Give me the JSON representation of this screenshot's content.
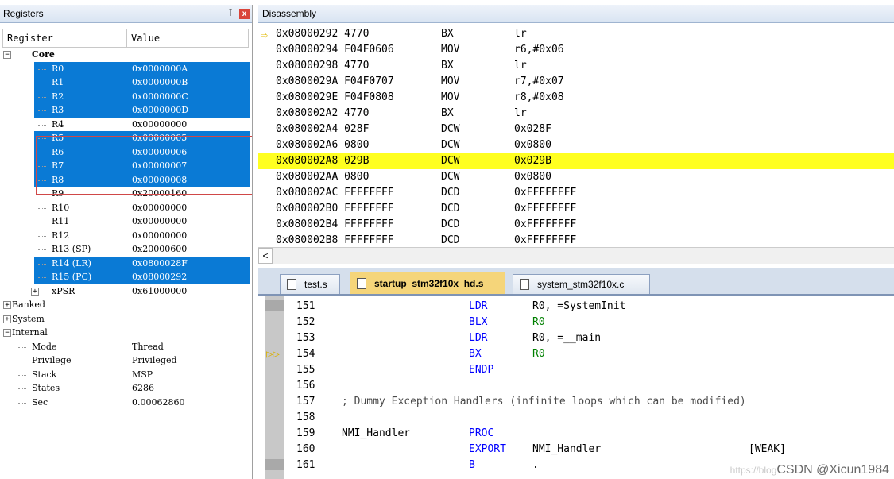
{
  "registers_panel": {
    "title": "Registers",
    "pin_glyph": "⍑",
    "close_glyph": "x",
    "col_register": "Register",
    "col_value": "Value",
    "core_label": "Core",
    "core_regs": [
      {
        "name": "R0",
        "value": "0x0000000A",
        "selected": true
      },
      {
        "name": "R1",
        "value": "0x0000000B",
        "selected": true
      },
      {
        "name": "R2",
        "value": "0x0000000C",
        "selected": true
      },
      {
        "name": "R3",
        "value": "0x0000000D",
        "selected": true
      },
      {
        "name": "R4",
        "value": "0x00000000",
        "selected": false
      },
      {
        "name": "R5",
        "value": "0x00000005",
        "selected": true
      },
      {
        "name": "R6",
        "value": "0x00000006",
        "selected": true
      },
      {
        "name": "R7",
        "value": "0x00000007",
        "selected": true
      },
      {
        "name": "R8",
        "value": "0x00000008",
        "selected": true
      },
      {
        "name": "R9",
        "value": "0x20000160",
        "selected": false
      },
      {
        "name": "R10",
        "value": "0x00000000",
        "selected": false
      },
      {
        "name": "R11",
        "value": "0x00000000",
        "selected": false
      },
      {
        "name": "R12",
        "value": "0x00000000",
        "selected": false
      },
      {
        "name": "R13 (SP)",
        "value": "0x20000600",
        "selected": false
      },
      {
        "name": "R14 (LR)",
        "value": "0x0800028F",
        "selected": true
      },
      {
        "name": "R15 (PC)",
        "value": "0x08000292",
        "selected": true
      }
    ],
    "xpsr": {
      "name": "xPSR",
      "value": "0x61000000"
    },
    "banked_label": "Banked",
    "system_label": "System",
    "internal_label": "Internal",
    "internal_items": [
      {
        "name": "Mode",
        "value": "Thread"
      },
      {
        "name": "Privilege",
        "value": "Privileged"
      },
      {
        "name": "Stack",
        "value": "MSP"
      },
      {
        "name": "States",
        "value": "6286"
      },
      {
        "name": "Sec",
        "value": "0.00062860"
      }
    ]
  },
  "disassembly": {
    "title": "Disassembly",
    "lines": [
      {
        "addr": "0x08000292 4770",
        "mn": "BX",
        "ops": "lr",
        "current": false,
        "arrow": true
      },
      {
        "addr": "0x08000294 F04F0606",
        "mn": "MOV",
        "ops": "r6,#0x06",
        "current": false,
        "arrow": false
      },
      {
        "addr": "0x08000298 4770",
        "mn": "BX",
        "ops": "lr",
        "current": false,
        "arrow": false
      },
      {
        "addr": "0x0800029A F04F0707",
        "mn": "MOV",
        "ops": "r7,#0x07",
        "current": false,
        "arrow": false
      },
      {
        "addr": "0x0800029E F04F0808",
        "mn": "MOV",
        "ops": "r8,#0x08",
        "current": false,
        "arrow": false
      },
      {
        "addr": "0x080002A2 4770",
        "mn": "BX",
        "ops": "lr",
        "current": false,
        "arrow": false
      },
      {
        "addr": "0x080002A4 028F",
        "mn": "DCW",
        "ops": "0x028F",
        "current": false,
        "arrow": false
      },
      {
        "addr": "0x080002A6 0800",
        "mn": "DCW",
        "ops": "0x0800",
        "current": false,
        "arrow": false
      },
      {
        "addr": "0x080002A8 029B",
        "mn": "DCW",
        "ops": "0x029B",
        "current": true,
        "arrow": false
      },
      {
        "addr": "0x080002AA 0800",
        "mn": "DCW",
        "ops": "0x0800",
        "current": false,
        "arrow": false
      },
      {
        "addr": "0x080002AC FFFFFFFF",
        "mn": "DCD",
        "ops": "0xFFFFFFFF",
        "current": false,
        "arrow": false
      },
      {
        "addr": "0x080002B0 FFFFFFFF",
        "mn": "DCD",
        "ops": "0xFFFFFFFF",
        "current": false,
        "arrow": false
      },
      {
        "addr": "0x080002B4 FFFFFFFF",
        "mn": "DCD",
        "ops": "0xFFFFFFFF",
        "current": false,
        "arrow": false
      },
      {
        "addr": "0x080002B8 FFFFFFFF",
        "mn": "DCD",
        "ops": "0xFFFFFFFF",
        "current": false,
        "arrow": false
      }
    ],
    "scroll_left_glyph": "<"
  },
  "tabs": [
    {
      "label": "test.s",
      "active": false
    },
    {
      "label": "startup_stm32f10x_hd.s",
      "active": true
    },
    {
      "label": "system_stm32f10x.c",
      "active": false
    }
  ],
  "editor": {
    "lines": [
      {
        "num": "151",
        "label": "",
        "kw": "LDR",
        "ops": "R0, =SystemInit",
        "ops_style": "plain",
        "comment": "",
        "attr": ""
      },
      {
        "num": "152",
        "label": "",
        "kw": "BLX",
        "ops": "R0",
        "ops_style": "green",
        "comment": "",
        "attr": ""
      },
      {
        "num": "153",
        "label": "",
        "kw": "LDR",
        "ops": "R0, =__main",
        "ops_style": "plain",
        "comment": "",
        "attr": ""
      },
      {
        "num": "154",
        "label": "",
        "kw": "BX",
        "ops": "R0",
        "ops_style": "green",
        "comment": "",
        "attr": ""
      },
      {
        "num": "155",
        "label": "",
        "kw": "ENDP",
        "ops": "",
        "ops_style": "plain",
        "comment": "",
        "attr": ""
      },
      {
        "num": "156",
        "label": "",
        "kw": "",
        "ops": "",
        "ops_style": "plain",
        "comment": "",
        "attr": ""
      },
      {
        "num": "157",
        "label": "",
        "kw": "",
        "ops": "",
        "ops_style": "plain",
        "comment": "; Dummy Exception Handlers (infinite loops which can be modified)",
        "attr": ""
      },
      {
        "num": "158",
        "label": "",
        "kw": "",
        "ops": "",
        "ops_style": "plain",
        "comment": "",
        "attr": ""
      },
      {
        "num": "159",
        "label": "NMI_Handler",
        "kw": "PROC",
        "ops": "",
        "ops_style": "plain",
        "comment": "",
        "attr": ""
      },
      {
        "num": "160",
        "label": "",
        "kw": "EXPORT",
        "ops": "NMI_Handler",
        "ops_style": "plain",
        "comment": "",
        "attr": "[WEAK]"
      },
      {
        "num": "161",
        "label": "",
        "kw": "B",
        "ops": ".",
        "ops_style": "plain",
        "comment": "",
        "attr": ""
      }
    ],
    "exec_arrow_line": 3,
    "gray_mark_lines": [
      0,
      10
    ]
  },
  "watermark": {
    "faint": "https://blog",
    "text": "CSDN @Xicun1984"
  },
  "colors": {
    "selection": "#0a7ad5",
    "current_line": "#ffff20",
    "keyword": "#0000ff",
    "operand": "#008000"
  }
}
